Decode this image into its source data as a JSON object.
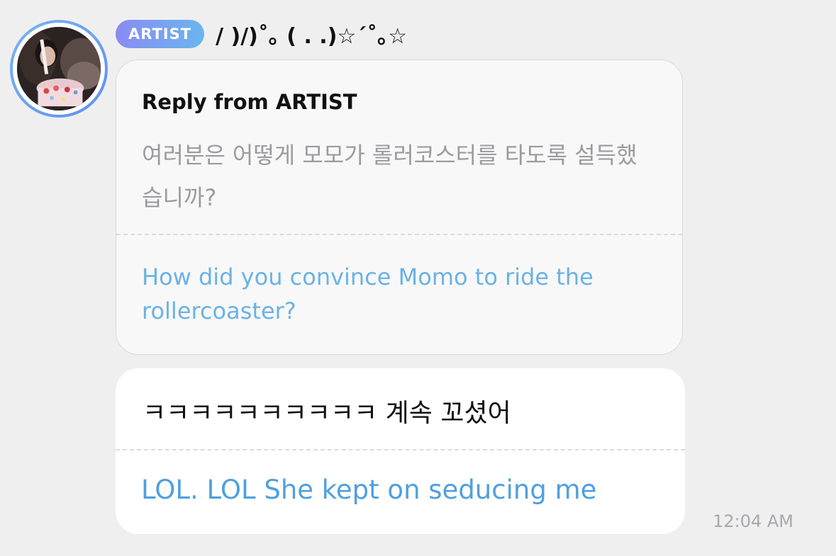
{
  "sender": {
    "badge": "ARTIST",
    "name": "/ )/)˚｡ ( . .)☆´˚｡☆",
    "avatar": "avatar-photo"
  },
  "reply": {
    "title": "Reply from ARTIST",
    "original_ko": "여러분은 어떻게 모모가 롤러코스터를 타도록 설득했습니까?",
    "original_en": "How did you convince Momo to ride the rollercoaster?"
  },
  "message": {
    "text_ko": "ㅋㅋㅋㅋㅋㅋㅋㅋㅋㅋ 계속 꼬셨어",
    "text_en": "LOL. LOL  She kept on seducing me",
    "time": "12:04 AM"
  },
  "colors": {
    "background": "#efeff0",
    "badge_gradient_start": "#8a8cf2",
    "badge_gradient_end": "#6ab6ee",
    "translation_blue": "#4f9fdf",
    "reply_translation_blue": "#6bb2e6",
    "muted_gray": "#9b9b9f"
  }
}
